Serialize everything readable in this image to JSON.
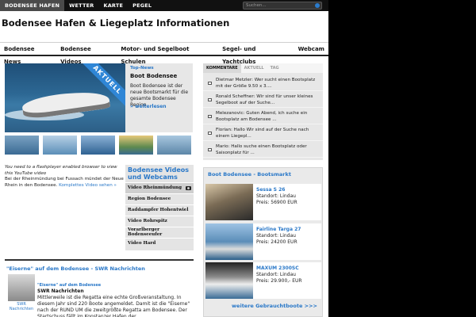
{
  "topnav": {
    "items": [
      "BODENSEE HAFEN",
      "WETTER",
      "KARTE",
      "PEGEL"
    ],
    "search_placeholder": "Suchen..."
  },
  "header": {
    "title": "Bodensee Hafen & Liegeplatz Informationen"
  },
  "mainnav": [
    "Bodensee News",
    "Bodensee Videos",
    "Motor- und Segelboot Schulen",
    "Segel- und Yachtclubs",
    "Webcam"
  ],
  "featured": {
    "ribbon": "AKTUELL",
    "tag": "Top-News",
    "title": "Boot Bodensee",
    "text": "Boot Bodensee ist der neue Bootsmarkt für die gesamte Bodensee Region.",
    "more": "» weiterlesen"
  },
  "video": {
    "flash_note": "You need to a flashplayer enabled browser to view this YouTube video",
    "text": "Bei der Rheinmündung bei Fussach mündet der Neue Rhein in den Bodensee.",
    "link": "Komplettes Video sehen »",
    "panel_title": "Bodensee Videos und Webcams",
    "items": [
      "Video Rheinmündung",
      "Region Bodensee",
      "Raddampfer Hohentwiel",
      "Video Rohrspitz",
      "Vorarlberger Bodenseeufer",
      "Video Hard"
    ]
  },
  "news": {
    "header": "\"Eiserne\" auf dem Bodensee - SWR Nachrichten",
    "thumb_caption": "SWR Nachrichten",
    "subtitle": "\"Eiserne\" auf dem Bodensee",
    "source": "SWR Nachrichten",
    "body": "Mittlerweile ist die Regatta eine echte Großveranstaltung. In diesem Jahr sind 220 Boote angemeldet. Damit ist die \"Eiserne\" nach der RUND UM die zweitgrößte Regatta am Bodensee. Der Startschuss fällt im Konstanzer Hafen der"
  },
  "comments": {
    "tabs": [
      "KOMMENTARE",
      "AKTUELL",
      "TAG"
    ],
    "items": [
      "Dietmar Metzler: Wer sucht einen Bootsplatz mit der Größe 9.50 x 3....",
      "Ronald Scheffner: Wir sind für unser kleines Segelboot auf der Suche...",
      "Melezanovic: Guten Abend, ich suche ein Bootsplatz am Bodensee ...",
      "Florian: Hallo Wir sind auf der Suche nach einem Liegepl...",
      "Mario: Hallo suche einen Bootsplatz oder Saisonplatz für ..."
    ]
  },
  "boats": {
    "title": "Boot Bodensee - Bootsmarkt",
    "items": [
      {
        "name": "Sessa S 26",
        "location": "Standort: Lindau",
        "price": "Preis: 56900 EUR"
      },
      {
        "name": "Fairline Targa 27",
        "location": "Standort: Lindau",
        "price": "Preis: 24200 EUR"
      },
      {
        "name": "MAXUM 2300SC",
        "location": "Standort: Lindau",
        "price": "Preis: 29.900,- EUR"
      }
    ],
    "more": "weitere Gebrauchtboote >>>"
  }
}
